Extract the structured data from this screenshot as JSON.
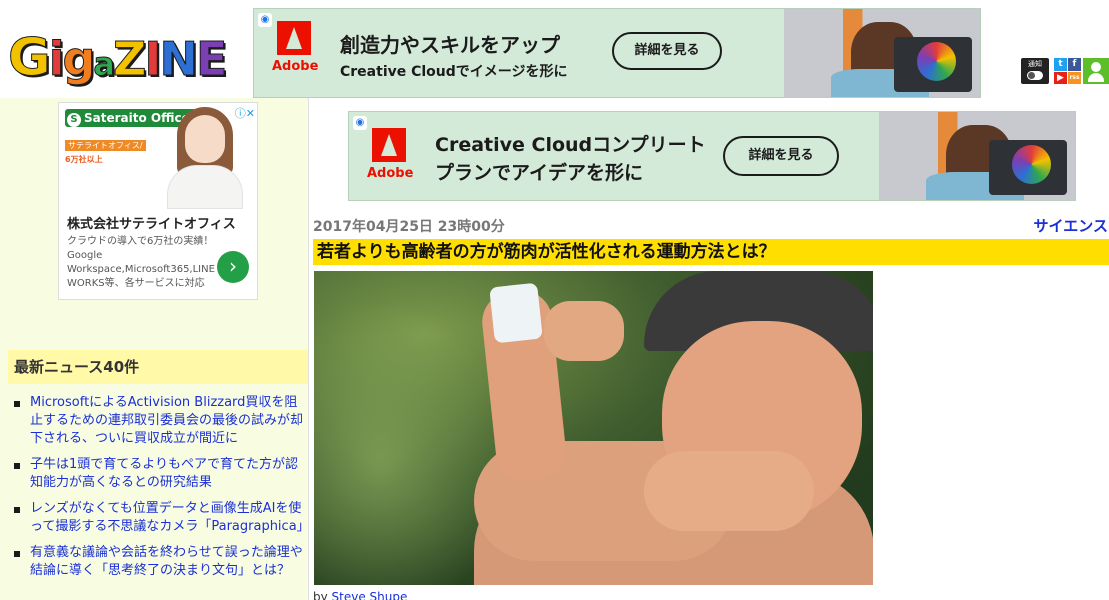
{
  "header": {
    "logo_letters": [
      "G",
      "i",
      "g",
      "a",
      "Z",
      "I",
      "N",
      "E"
    ],
    "icons": {
      "notify_label": "通知",
      "notify_toggle_label": "OFF",
      "twitter": "t",
      "facebook": "f",
      "youtube": "▶",
      "rss": "rss"
    }
  },
  "ads": {
    "top_banner": {
      "brand": "Adobe",
      "headline_line1": "創造力やスキルをアップ",
      "headline_line2": "Creative Cloudでイメージを形に",
      "cta": "詳細を見る"
    },
    "mid_banner": {
      "brand": "Adobe",
      "headline_line1": "Creative Cloudコンプリート",
      "headline_line2": "プランでアイデアを形に",
      "cta": "詳細を見る"
    },
    "side_ad": {
      "brand": "Sateraito Office",
      "promo_line1": "サテライトオフィス/",
      "promo_line2": "6万社以上",
      "company": "株式会社サテライトオフィス",
      "description": "クラウドの導入で6万社の実績！Google Workspace,Microsoft365,LINE WORKS等、各サービスに対応",
      "cta_icon": "›"
    }
  },
  "sidebar": {
    "news_heading": "最新ニュース40件",
    "news": [
      "MicrosoftによるActivision Blizzard買収を阻止するための連邦取引委員会の最後の試みが却下される、ついに買収成立が間近に",
      "子牛は1頭で育てるよりもペアで育てた方が認知能力が高くなるとの研究結果",
      "レンズがなくても位置データと画像生成AIを使って撮影する不思議なカメラ「Paragraphica」",
      "有意義な議論や会話を終わらせて誤った論理や結論に導く「思考終了の決まり文句」とは？"
    ]
  },
  "article": {
    "date": "2017年04月25日 23時00分",
    "category": "サイエンス",
    "title": "若者よりも高齢者の方が筋肉が活性化される運動方法とは？",
    "byline_prefix": "by ",
    "byline_author": "Steve Shupe"
  },
  "colors": {
    "sidebar_bg": "#f8fde1",
    "title_bar": "#ffde00",
    "news_heading_bg": "#fff9a8",
    "link": "#1a2fd6",
    "ad_bg": "#d4ead9"
  }
}
